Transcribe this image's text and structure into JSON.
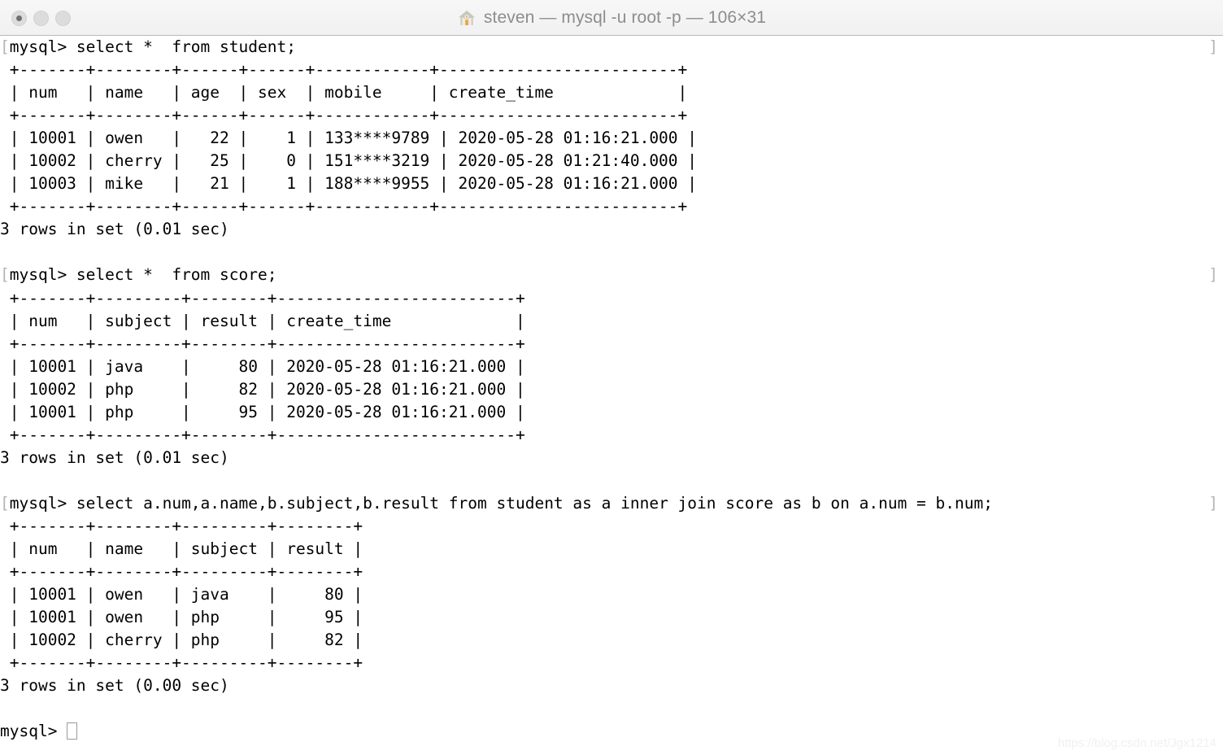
{
  "window": {
    "title": "steven — mysql -u root -p — 106×31",
    "icon": "home-icon",
    "columns": 106,
    "rows": 31,
    "background_color": "#ffffff",
    "text_color": "#000000",
    "titlebar_color": "#f3f3f3",
    "prompt_mark_color": "#b4b4b4"
  },
  "traffic_lights": [
    {
      "name": "close-button",
      "label": "Close"
    },
    {
      "name": "minimize-button",
      "label": "Minimize"
    },
    {
      "name": "zoom-button",
      "label": "Zoom"
    }
  ],
  "terminal": {
    "prompt": "mysql>",
    "mark_open": "[",
    "mark_close": "]",
    "lines": [
      {
        "type": "prompt",
        "text": "[mysql> select *  from student;",
        "mark_right": "]"
      },
      {
        "type": "output",
        "text": " +-------+--------+------+------+------------+-------------------------+"
      },
      {
        "type": "output",
        "text": " | num   | name   | age  | sex  | mobile     | create_time             |"
      },
      {
        "type": "output",
        "text": " +-------+--------+------+------+------------+-------------------------+"
      },
      {
        "type": "output",
        "text": " | 10001 | owen   |   22 |    1 | 133****9789 | 2020-05-28 01:16:21.000 |"
      },
      {
        "type": "output",
        "text": " | 10002 | cherry |   25 |    0 | 151****3219 | 2020-05-28 01:21:40.000 |"
      },
      {
        "type": "output",
        "text": " | 10003 | mike   |   21 |    1 | 188****9955 | 2020-05-28 01:16:21.000 |"
      },
      {
        "type": "output",
        "text": " +-------+--------+------+------+------------+-------------------------+"
      },
      {
        "type": "output",
        "text": "3 rows in set (0.01 sec)"
      },
      {
        "type": "blank",
        "text": ""
      },
      {
        "type": "prompt",
        "text": "[mysql> select *  from score;",
        "mark_right": "]"
      },
      {
        "type": "output",
        "text": " +-------+---------+--------+-------------------------+"
      },
      {
        "type": "output",
        "text": " | num   | subject | result | create_time             |"
      },
      {
        "type": "output",
        "text": " +-------+---------+--------+-------------------------+"
      },
      {
        "type": "output",
        "text": " | 10001 | java    |     80 | 2020-05-28 01:16:21.000 |"
      },
      {
        "type": "output",
        "text": " | 10002 | php     |     82 | 2020-05-28 01:16:21.000 |"
      },
      {
        "type": "output",
        "text": " | 10001 | php     |     95 | 2020-05-28 01:16:21.000 |"
      },
      {
        "type": "output",
        "text": " +-------+---------+--------+-------------------------+"
      },
      {
        "type": "output",
        "text": "3 rows in set (0.01 sec)"
      },
      {
        "type": "blank",
        "text": ""
      },
      {
        "type": "prompt",
        "text": "[mysql> select a.num,a.name,b.subject,b.result from student as a inner join score as b on a.num = b.num;",
        "mark_right": "]"
      },
      {
        "type": "output",
        "text": " +-------+--------+---------+--------+"
      },
      {
        "type": "output",
        "text": " | num   | name   | subject | result |"
      },
      {
        "type": "output",
        "text": " +-------+--------+---------+--------+"
      },
      {
        "type": "output",
        "text": " | 10001 | owen   | java    |     80 |"
      },
      {
        "type": "output",
        "text": " | 10001 | owen   | php     |     95 |"
      },
      {
        "type": "output",
        "text": " | 10002 | cherry | php     |     82 |"
      },
      {
        "type": "output",
        "text": " +-------+--------+---------+--------+"
      },
      {
        "type": "output",
        "text": "3 rows in set (0.00 sec)"
      },
      {
        "type": "blank",
        "text": ""
      },
      {
        "type": "cursor",
        "text": "mysql> "
      }
    ]
  },
  "queries": [
    {
      "sql": "select *  from student;",
      "result_rows": 3,
      "duration": "0.01 sec",
      "status": "3 rows in set (0.01 sec)",
      "columns": [
        "num",
        "name",
        "age",
        "sex",
        "mobile",
        "create_time"
      ],
      "rows": [
        [
          "10001",
          "owen",
          "22",
          "1",
          "133****9789",
          "2020-05-28 01:16:21.000"
        ],
        [
          "10002",
          "cherry",
          "25",
          "0",
          "151****3219",
          "2020-05-28 01:21:40.000"
        ],
        [
          "10003",
          "mike",
          "21",
          "1",
          "188****9955",
          "2020-05-28 01:16:21.000"
        ]
      ]
    },
    {
      "sql": "select *  from score;",
      "result_rows": 3,
      "duration": "0.01 sec",
      "status": "3 rows in set (0.01 sec)",
      "columns": [
        "num",
        "subject",
        "result",
        "create_time"
      ],
      "rows": [
        [
          "10001",
          "java",
          "80",
          "2020-05-28 01:16:21.000"
        ],
        [
          "10002",
          "php",
          "82",
          "2020-05-28 01:16:21.000"
        ],
        [
          "10001",
          "php",
          "95",
          "2020-05-28 01:16:21.000"
        ]
      ]
    },
    {
      "sql": "select a.num,a.name,b.subject,b.result from student as a inner join score as b on a.num = b.num;",
      "result_rows": 3,
      "duration": "0.00 sec",
      "status": "3 rows in set (0.00 sec)",
      "columns": [
        "num",
        "name",
        "subject",
        "result"
      ],
      "rows": [
        [
          "10001",
          "owen",
          "java",
          "80"
        ],
        [
          "10001",
          "owen",
          "php",
          "95"
        ],
        [
          "10002",
          "cherry",
          "php",
          "82"
        ]
      ]
    }
  ],
  "watermark": "https://blog.csdn.net/Jgx1214"
}
